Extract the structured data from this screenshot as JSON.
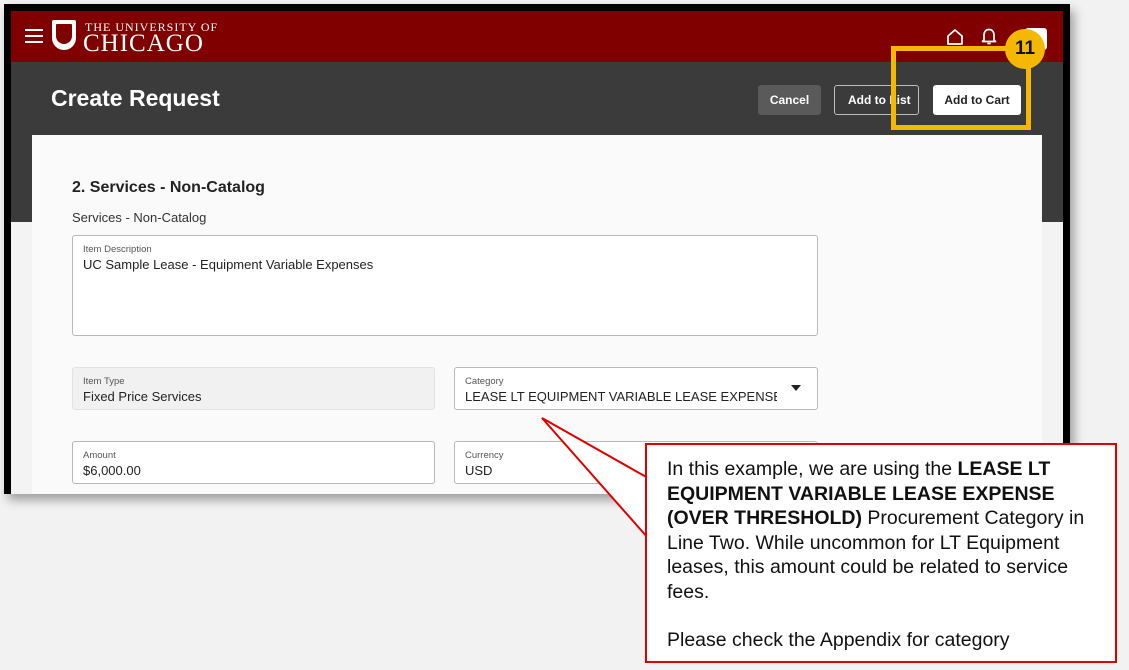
{
  "header": {
    "logo_line1": "THE UNIVERSITY OF",
    "logo_line2": "CHICAGO"
  },
  "page": {
    "title": "Create Request",
    "buttons": {
      "cancel": "Cancel",
      "add_to_list": "Add to List",
      "add_to_cart": "Add to Cart"
    }
  },
  "step_badge": "11",
  "form": {
    "section_title": "2. Services - Non-Catalog",
    "section_subtitle": "Services - Non-Catalog",
    "item_description": {
      "label": "Item Description",
      "value": "UC Sample Lease - Equipment Variable Expenses"
    },
    "item_type": {
      "label": "Item Type",
      "value": "Fixed Price Services"
    },
    "category": {
      "label": "Category",
      "value": "LEASE LT EQUIPMENT VARIABLE LEASE EXPENSE"
    },
    "amount": {
      "label": "Amount",
      "value": "$6,000.00"
    },
    "currency": {
      "label": "Currency",
      "value": "USD"
    }
  },
  "callout": {
    "intro": "In this example, we are using the ",
    "bold": "LEASE LT EQUIPMENT VARIABLE LEASE EXPENSE (OVER THRESHOLD)",
    "rest": " Procurement Category in Line Two. While uncommon for LT Equipment leases, this amount could be related to service fees.",
    "note": "Please check the Appendix for category"
  },
  "colors": {
    "brand": "#800000",
    "header": "#3b3b3b",
    "highlight": "#f5b800",
    "callout_border": "#e00000"
  }
}
